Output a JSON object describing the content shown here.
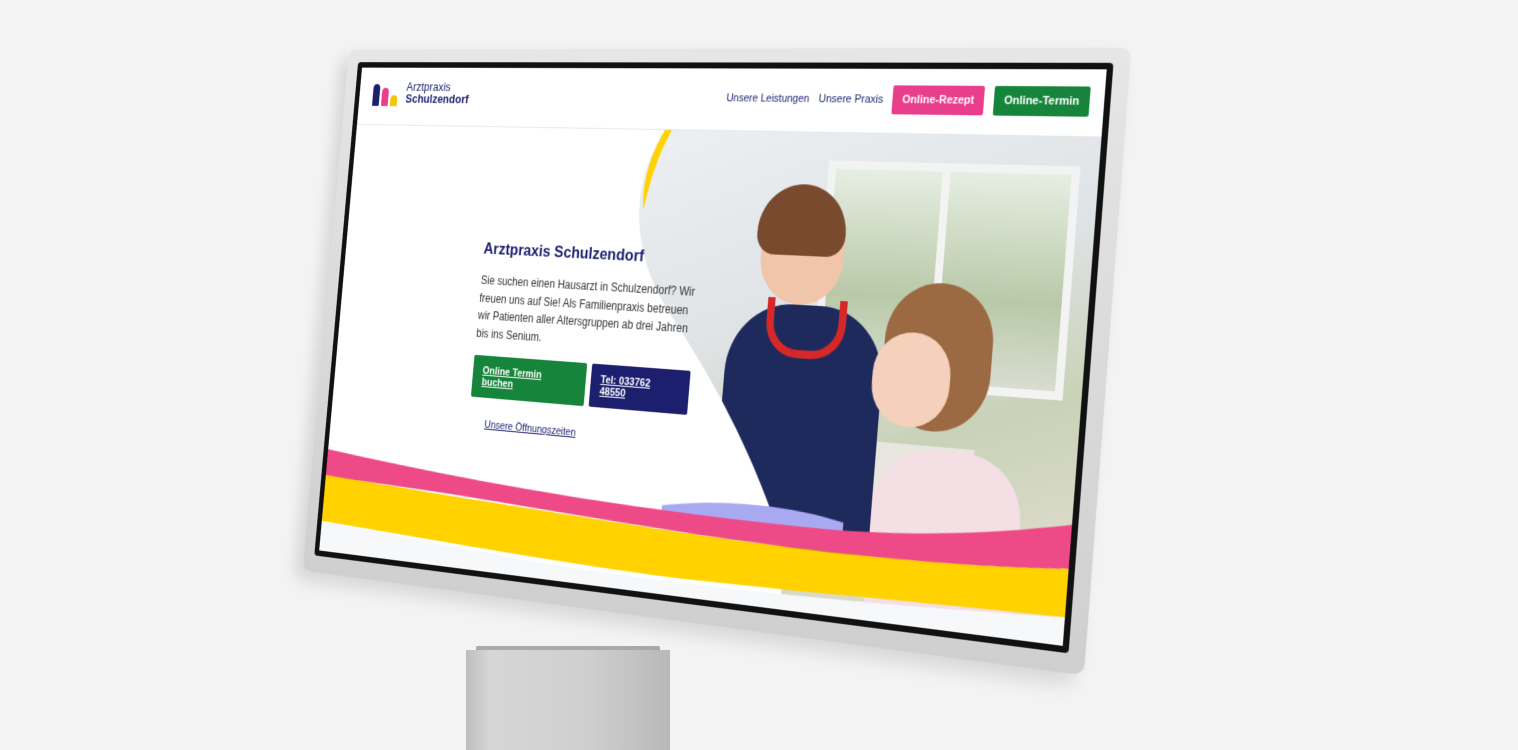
{
  "logo": {
    "line1": "Arztpraxis",
    "line2": "Schulzendorf"
  },
  "nav": {
    "items": [
      {
        "label": "Unsere Leistungen"
      },
      {
        "label": "Unsere Praxis"
      }
    ],
    "rezept_label": "Online-Rezept",
    "termin_label": "Online-Termin"
  },
  "hero": {
    "title": "Arztpraxis Schulzendorf",
    "description": "Sie suchen einen Hausarzt in Schulzendorf? Wir freuen uns auf Sie! Als Familienpraxis betreuen wir Patienten aller Altersgruppen ab drei Jahren bis ins Senium.",
    "book_button": "Online Termin buchen",
    "phone_button": "Tel: 033762 48550",
    "hours_link": "Unsere Öffnungszeiten"
  },
  "colors": {
    "navy": "#1b1f6e",
    "pink": "#e83e8c",
    "green": "#16843a",
    "yellow": "#ffd200",
    "lavender": "#a9a9f2"
  },
  "icons": [
    "family-logo-icon"
  ]
}
